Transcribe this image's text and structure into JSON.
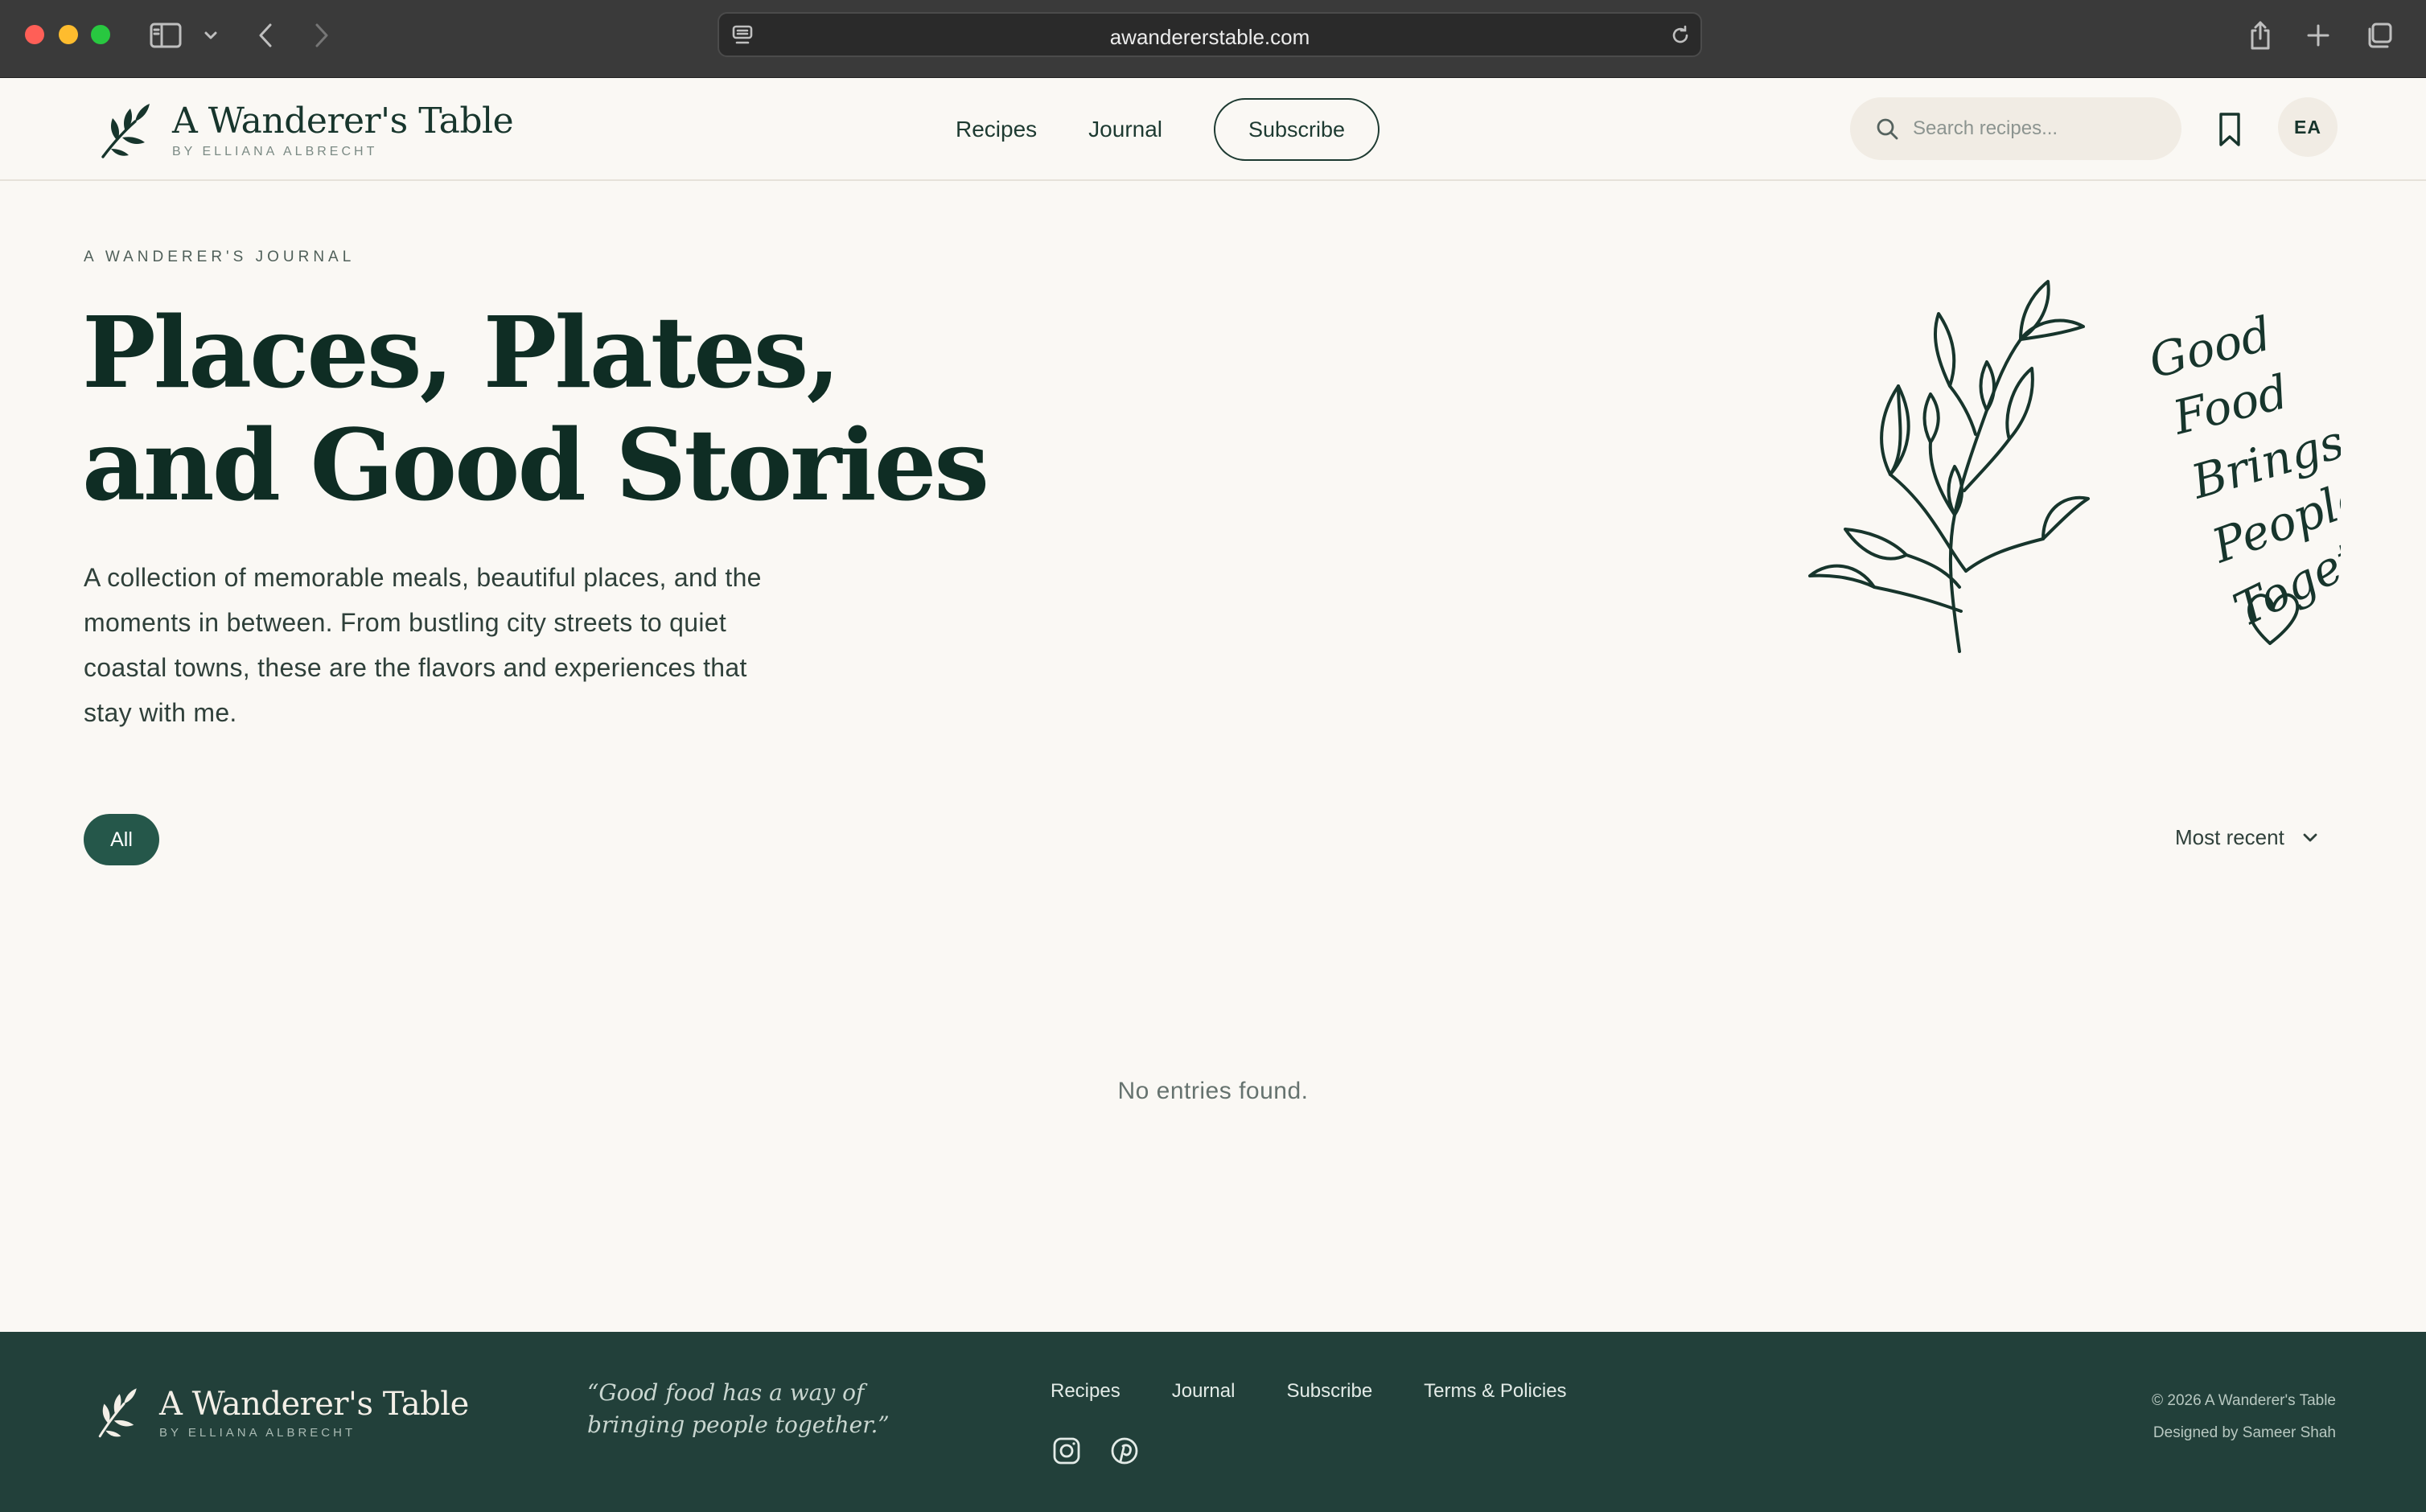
{
  "browser": {
    "url": "awandererstable.com"
  },
  "header": {
    "brand_title": "A Wanderer's Table",
    "brand_subtitle": "BY ELLIANA ALBRECHT",
    "nav": {
      "recipes": "Recipes",
      "journal": "Journal",
      "subscribe": "Subscribe"
    },
    "search_placeholder": "Search recipes...",
    "avatar_initials": "EA"
  },
  "hero": {
    "eyebrow": "A WANDERER'S JOURNAL",
    "title_line1": "Places, Plates,",
    "title_line2": "and Good Stories",
    "description": "A collection of memorable meals, beautiful places, and the moments in between. From bustling city streets to quiet coastal towns, these are the flavors and experiences that stay with me.",
    "illustration_quote": "Good Food Brings People Together\""
  },
  "filters": {
    "active_chip": "All",
    "sort_value": "Most recent"
  },
  "entries": {
    "empty_message": "No entries found."
  },
  "footer": {
    "brand_title": "A Wanderer's Table",
    "brand_subtitle": "BY ELLIANA ALBRECHT",
    "quote": "“Good food has a way of bringing people together.”",
    "links": {
      "recipes": "Recipes",
      "journal": "Journal",
      "subscribe": "Subscribe",
      "terms": "Terms & Policies"
    },
    "social": [
      "instagram-icon",
      "pinterest-icon"
    ],
    "copyright": "© 2026 A Wanderer's Table",
    "credit": "Designed by Sameer Shah"
  },
  "colors": {
    "brand_dark": "#0f2d24",
    "accent_green": "#25574a",
    "footer_bg": "#22403a",
    "page_bg": "#faf8f4"
  }
}
